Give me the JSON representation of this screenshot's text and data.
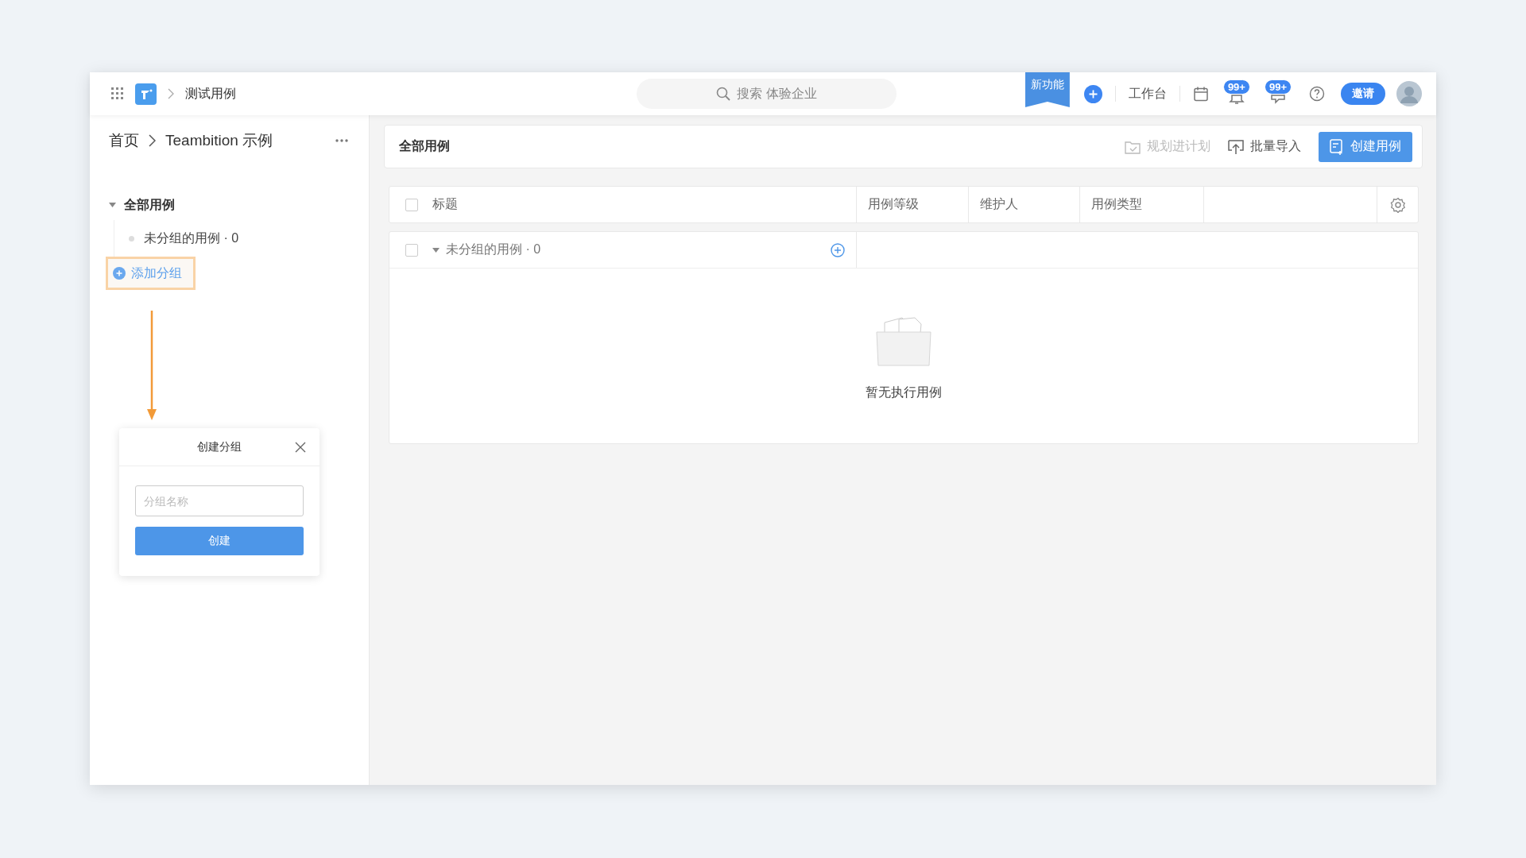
{
  "top_bar": {
    "breadcrumb": "测试用例",
    "search": {
      "placeholder": "搜索 体验企业"
    },
    "new_feature_ribbon": "新功能",
    "workbench": "工作台",
    "notification_badges": [
      "99+",
      "99+"
    ],
    "invite_button": "邀请"
  },
  "sidebar": {
    "breadcrumb": [
      "首页",
      "Teambition 示例"
    ],
    "tree": [
      {
        "label": "全部用例",
        "expanded": true,
        "children": [
          {
            "label": "未分组的用例 · 0"
          }
        ]
      }
    ],
    "add_group": "添加分组",
    "add_group_highlighted": true
  },
  "popup": {
    "title": "创建分组",
    "name_field": {
      "placeholder": "分组名称"
    },
    "create_button": "创建"
  },
  "main": {
    "title": "全部用例",
    "actions": [
      {
        "label": "规划进计划",
        "disabled": true
      },
      {
        "label": "批量导入",
        "disabled": false
      }
    ],
    "create_button": "创建用例",
    "select_all_checked": false,
    "table": {
      "columns": [
        "标题",
        "用例等级",
        "维护人",
        "用例类型"
      ],
      "groups": [
        {
          "label": "未分组的用例 · 0",
          "expanded": true,
          "checked": false
        }
      ],
      "empty_text": "暂无执行用例"
    }
  }
}
